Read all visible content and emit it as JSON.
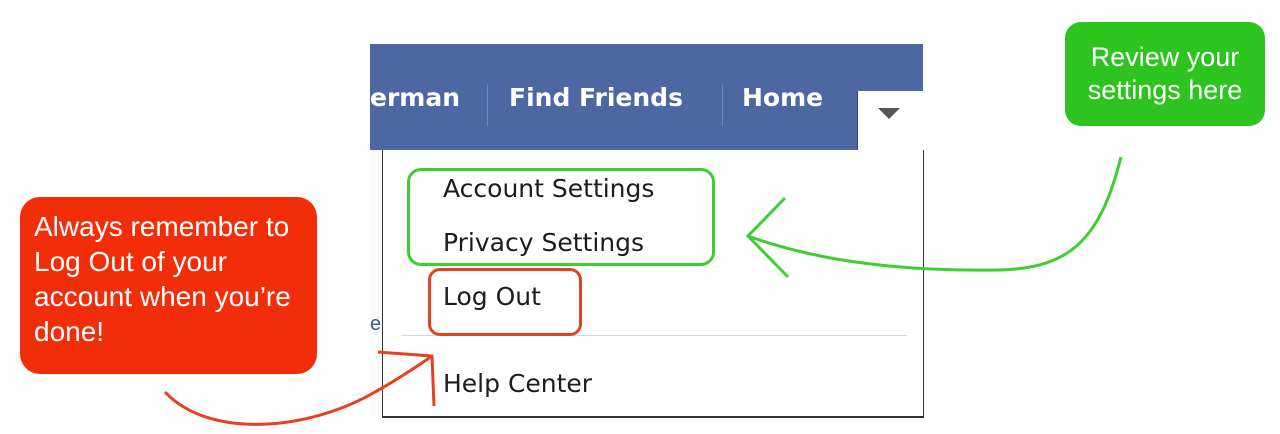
{
  "navbar": {
    "name_fragment": "erman",
    "find_friends": "Find Friends",
    "home": "Home"
  },
  "dropdown_menu": {
    "items": [
      "Account Settings",
      "Privacy Settings",
      "Log Out",
      "Help Center"
    ]
  },
  "callouts": {
    "green": "Review your settings here",
    "red": "Always remember to Log Out of your account when you’re done!"
  },
  "colors": {
    "facebook_blue": "#4d67a3",
    "green_annotation": "#2ec41f",
    "red_annotation": "#f22e0a"
  },
  "icons": {
    "dropdown": "chevron-down-icon"
  }
}
